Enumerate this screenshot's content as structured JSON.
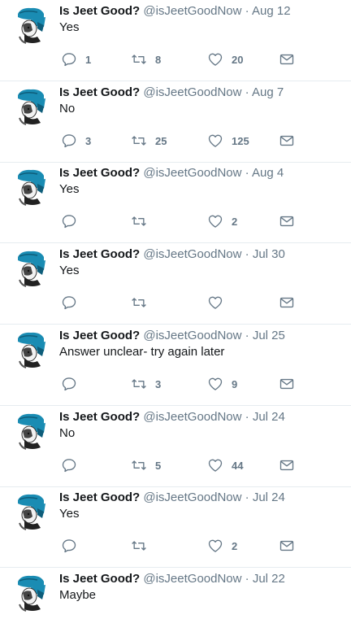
{
  "account": {
    "name": "Is Jeet Good?",
    "handle": "@isJeetGoodNow",
    "separator": "·"
  },
  "icons": {
    "reply": "reply-icon",
    "retweet": "retweet-icon",
    "like": "heart-icon",
    "message": "envelope-icon",
    "avatar": "avatar-image"
  },
  "colors": {
    "text": "#14171a",
    "muted": "#657786",
    "divider": "#e6ecf0",
    "avatar_blue": "#1a8cb3"
  },
  "tweets": [
    {
      "date": "Aug 12",
      "text": "Yes",
      "replies": "1",
      "retweets": "8",
      "likes": "20"
    },
    {
      "date": "Aug 7",
      "text": "No",
      "replies": "3",
      "retweets": "25",
      "likes": "125"
    },
    {
      "date": "Aug 4",
      "text": "Yes",
      "replies": "",
      "retweets": "",
      "likes": "2"
    },
    {
      "date": "Jul 30",
      "text": "Yes",
      "replies": "",
      "retweets": "",
      "likes": ""
    },
    {
      "date": "Jul 25",
      "text": "Answer unclear- try again later",
      "replies": "",
      "retweets": "3",
      "likes": "9"
    },
    {
      "date": "Jul 24",
      "text": "No",
      "replies": "",
      "retweets": "5",
      "likes": "44"
    },
    {
      "date": "Jul 24",
      "text": "Yes",
      "replies": "",
      "retweets": "",
      "likes": "2"
    },
    {
      "date": "Jul 22",
      "text": "Maybe",
      "replies": "",
      "retweets": "",
      "likes": ""
    }
  ]
}
